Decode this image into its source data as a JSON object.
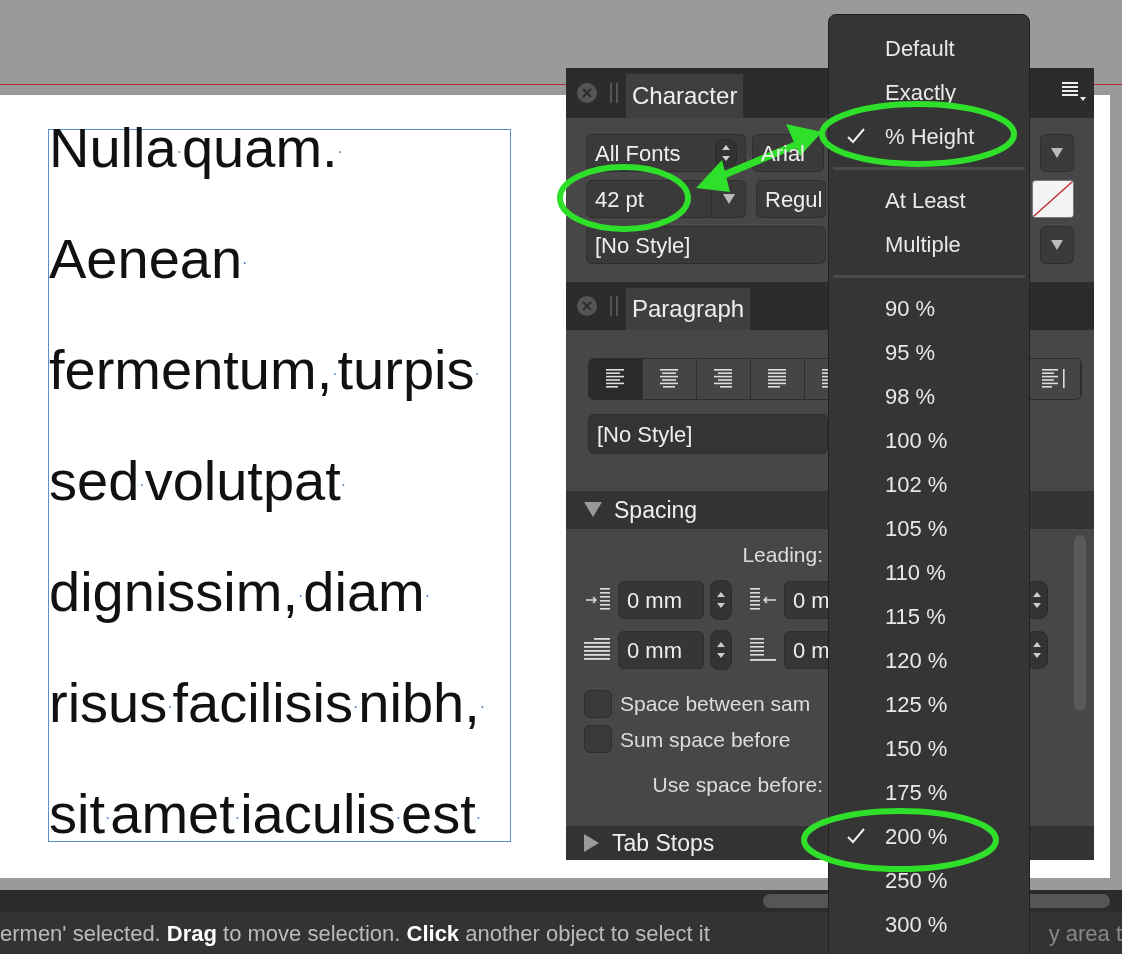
{
  "document": {
    "lines": [
      "Nulla·quam.·",
      "Aenean·",
      "fermentum,·turpis·",
      "sed·volutpat·",
      "dignissim,·diam·",
      "risus·facilisis·nibh,·",
      "sit·amet·iaculis·est·"
    ]
  },
  "character_panel": {
    "tab": "Character",
    "font_collection": "All Fonts",
    "font": "Arial",
    "size": "42 pt",
    "style": "Regul",
    "character_style": "[No Style]"
  },
  "paragraph_panel": {
    "tab": "Paragraph",
    "alignments": [
      {
        "kind": "left",
        "selected": true
      },
      {
        "kind": "center",
        "selected": false
      },
      {
        "kind": "right",
        "selected": false
      },
      {
        "kind": "justify",
        "selected": false
      },
      {
        "kind": "justify",
        "selected": false
      },
      {
        "kind": "spine",
        "selected": false
      }
    ],
    "paragraph_style": "[No Style]",
    "spacing": {
      "title": "Spacing",
      "expanded": true,
      "leading_label": "Leading:",
      "indent_rows": [
        {
          "kind": "indent",
          "left": "0 mm",
          "right": "0 m"
        },
        {
          "kind": "space",
          "left": "0 mm",
          "right": "0 m"
        }
      ],
      "checkboxes": [
        {
          "label": "Space between sam",
          "checked": false
        },
        {
          "label": "Sum space before",
          "checked": false
        }
      ],
      "use_space_label": "Use space before:"
    },
    "tab_stops": {
      "title": "Tab Stops",
      "expanded": false
    }
  },
  "leading_menu": {
    "groups": [
      [
        {
          "label": "Default",
          "checked": false
        },
        {
          "label": "Exactly",
          "checked": false
        },
        {
          "label": "% Height",
          "checked": true
        }
      ],
      [
        {
          "label": "At Least",
          "checked": false
        },
        {
          "label": "Multiple",
          "checked": false
        }
      ],
      [
        {
          "label": "90 %",
          "checked": false
        },
        {
          "label": "95 %",
          "checked": false
        },
        {
          "label": "98 %",
          "checked": false
        },
        {
          "label": "100 %",
          "checked": false
        },
        {
          "label": "102 %",
          "checked": false
        },
        {
          "label": "105 %",
          "checked": false
        },
        {
          "label": "110 %",
          "checked": false
        },
        {
          "label": "115 %",
          "checked": false
        },
        {
          "label": "120 %",
          "checked": false
        },
        {
          "label": "125 %",
          "checked": false
        },
        {
          "label": "150 %",
          "checked": false
        },
        {
          "label": "175 %",
          "checked": false
        },
        {
          "label": "200 %",
          "checked": true
        },
        {
          "label": "250 %",
          "checked": false
        },
        {
          "label": "300 %",
          "checked": false
        }
      ]
    ]
  },
  "status_bar": {
    "message": "ermen' selected. **Drag** to move selection. **Click** another object to select it",
    "message_tail": "y area t"
  }
}
